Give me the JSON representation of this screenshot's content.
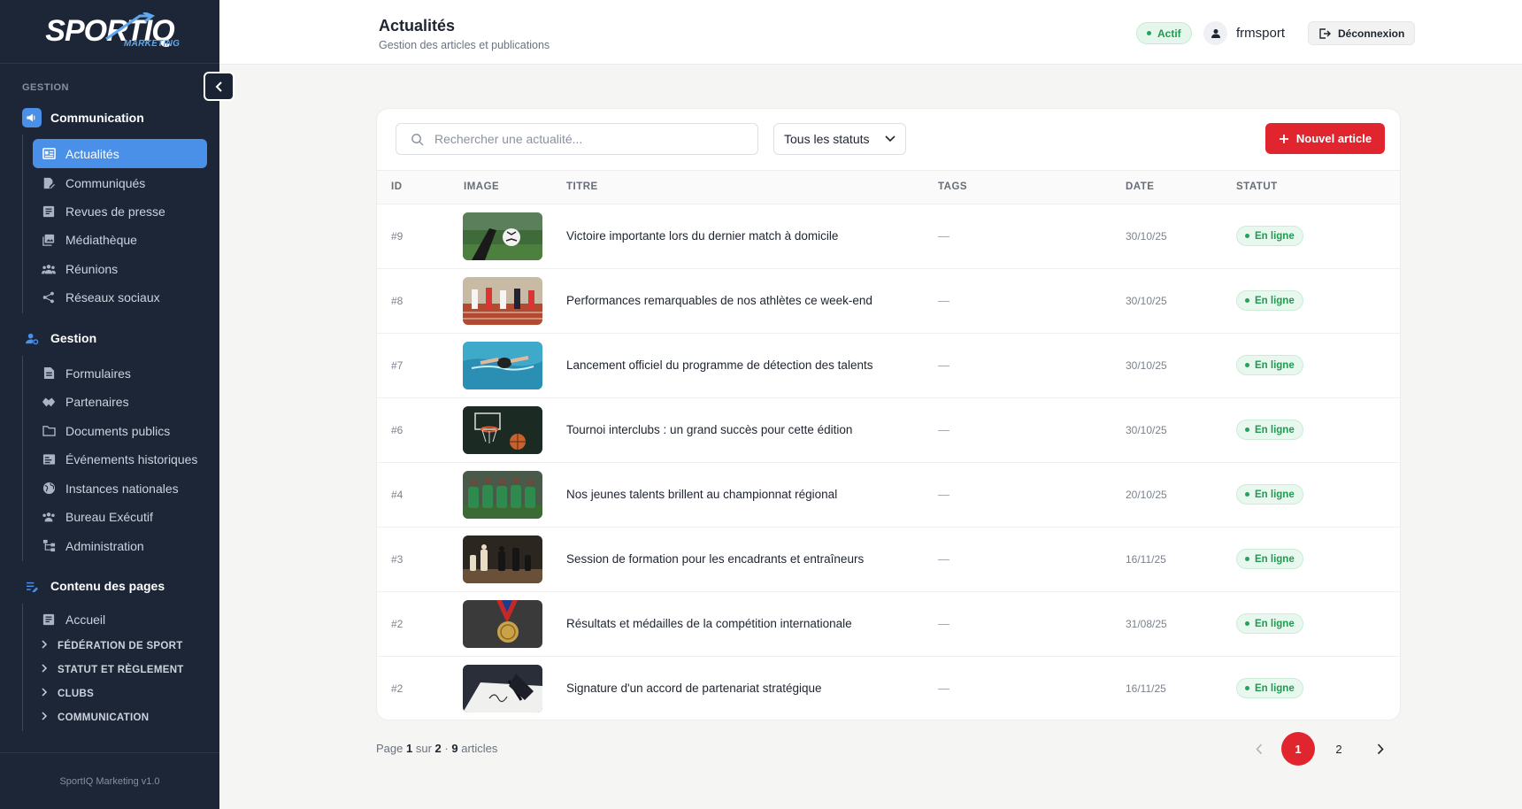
{
  "brand": {
    "logo_text": "SPORTIQ",
    "logo_sub": "MARKETING",
    "footer": "SportIQ Marketing v1.0"
  },
  "sidebar": {
    "section_label": "GESTION",
    "groups": [
      {
        "label": "Communication",
        "icon": "megaphone-icon",
        "items": [
          {
            "label": "Actualités",
            "icon": "newspaper-icon",
            "active": true
          },
          {
            "label": "Communiqués",
            "icon": "edit-document-icon"
          },
          {
            "label": "Revues de presse",
            "icon": "article-icon"
          },
          {
            "label": "Médiathèque",
            "icon": "gallery-icon"
          },
          {
            "label": "Réunions",
            "icon": "people-icon"
          },
          {
            "label": "Réseaux sociaux",
            "icon": "share-icon"
          }
        ]
      },
      {
        "label": "Gestion",
        "icon": "manage-accounts-icon",
        "items": [
          {
            "label": "Formulaires",
            "icon": "form-icon"
          },
          {
            "label": "Partenaires",
            "icon": "handshake-icon"
          },
          {
            "label": "Documents publics",
            "icon": "folder-icon"
          },
          {
            "label": "Événements historiques",
            "icon": "history-icon"
          },
          {
            "label": "Instances nationales",
            "icon": "globe-icon"
          },
          {
            "label": "Bureau Exécutif",
            "icon": "group-icon"
          },
          {
            "label": "Administration",
            "icon": "hierarchy-icon"
          }
        ]
      },
      {
        "label": "Contenu des pages",
        "icon": "edit-list-icon",
        "items": [
          {
            "label": "Accueil",
            "icon": "home-article-icon"
          }
        ],
        "subsections": [
          "FÉDÉRATION DE SPORT",
          "STATUT ET RÈGLEMENT",
          "CLUBS",
          "COMMUNICATION"
        ]
      }
    ]
  },
  "header": {
    "title": "Actualités",
    "subtitle": "Gestion des articles et publications",
    "status_badge": "Actif",
    "username": "frmsport",
    "logout_label": "Déconnexion"
  },
  "toolbar": {
    "search_placeholder": "Rechercher une actualité...",
    "status_filter": "Tous les statuts",
    "new_button": "Nouvel article"
  },
  "table": {
    "columns": [
      "ID",
      "IMAGE",
      "TITRE",
      "TAGS",
      "DATE",
      "STATUT"
    ],
    "rows": [
      {
        "id": "#9",
        "image": "football-photo",
        "title": "Victoire importante lors du dernier match à domicile",
        "tags": "—",
        "date": "30/10/25",
        "status": "En ligne"
      },
      {
        "id": "#8",
        "image": "athletics-photo",
        "title": "Performances remarquables de nos athlètes ce week-end",
        "tags": "—",
        "date": "30/10/25",
        "status": "En ligne"
      },
      {
        "id": "#7",
        "image": "swimming-photo",
        "title": "Lancement officiel du programme de détection des talents",
        "tags": "—",
        "date": "30/10/25",
        "status": "En ligne"
      },
      {
        "id": "#6",
        "image": "basketball-photo",
        "title": "Tournoi interclubs : un grand succès pour cette édition",
        "tags": "—",
        "date": "30/10/25",
        "status": "En ligne"
      },
      {
        "id": "#4",
        "image": "team-photo",
        "title": "Nos jeunes talents brillent au championnat régional",
        "tags": "—",
        "date": "20/10/25",
        "status": "En ligne"
      },
      {
        "id": "#3",
        "image": "chess-photo",
        "title": "Session de formation pour les encadrants et entraîneurs",
        "tags": "—",
        "date": "16/11/25",
        "status": "En ligne"
      },
      {
        "id": "#2",
        "image": "medal-photo",
        "title": "Résultats et médailles de la compétition internationale",
        "tags": "—",
        "date": "31/08/25",
        "status": "En ligne"
      },
      {
        "id": "#2",
        "image": "signature-photo",
        "title": "Signature d'un accord de partenariat stratégique",
        "tags": "—",
        "date": "16/11/25",
        "status": "En ligne"
      }
    ]
  },
  "pagination": {
    "page_word": "Page",
    "current": "1",
    "of_word": "sur",
    "total_pages": "2",
    "separator": "·",
    "count": "9",
    "count_word": "articles",
    "pages": [
      "1",
      "2"
    ]
  },
  "colors": {
    "sidebar_bg": "#1c2637",
    "accent_blue": "#4a8fe8",
    "primary_red": "#e1252f",
    "success_green": "#1f9b50"
  }
}
